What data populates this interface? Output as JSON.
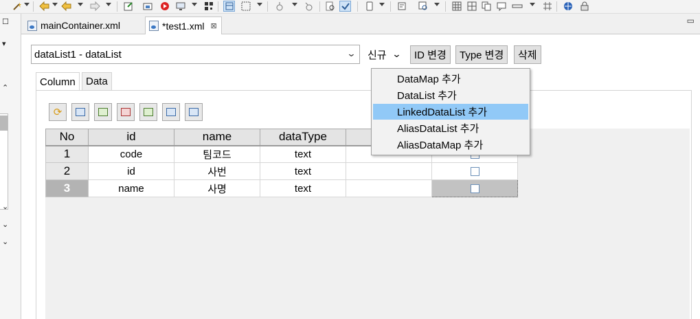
{
  "toolbar": {
    "icons": [
      "wand-icon",
      "back-arrow-icon",
      "forward-arrow-icon",
      "new-file-icon",
      "open-icon",
      "run-icon",
      "monitor-icon",
      "qr-icon",
      "layout-active-icon",
      "grid-select-icon",
      "node-icon",
      "node2-icon",
      "find-icon",
      "spell-check-icon",
      "phone-icon",
      "tag-icon",
      "inspect-icon",
      "table-grid-icon",
      "copy-icon",
      "comment-icon",
      "line-icon",
      "hash-icon",
      "globe-icon",
      "lock-icon"
    ]
  },
  "editor_tabs": [
    {
      "label": "mainContainer.xml",
      "active": false
    },
    {
      "label": "*test1.xml",
      "active": true,
      "close": "⊠"
    }
  ],
  "header": {
    "combo_value": "dataList1 - dataList",
    "new_menu_label": "신규",
    "id_change_label": "ID 변경",
    "type_change_label": "Type 변경",
    "delete_label": "삭제"
  },
  "inner_tabs": [
    {
      "label": "Column",
      "active": true
    },
    {
      "label": "Data",
      "active": false
    }
  ],
  "grid": {
    "columns": [
      "No",
      "id",
      "name",
      "dataType",
      "",
      ""
    ],
    "rows": [
      {
        "no": "1",
        "id": "code",
        "name": "팀코드",
        "dataType": "text",
        "checked": false
      },
      {
        "no": "2",
        "id": "id",
        "name": "사번",
        "dataType": "text",
        "checked": false
      },
      {
        "no": "3",
        "id": "name",
        "name": "사명",
        "dataType": "text",
        "checked": false,
        "selected": true
      }
    ]
  },
  "popup_menu": {
    "items": [
      {
        "label": "DataMap 추가",
        "highlighted": false
      },
      {
        "label": "DataList 추가",
        "highlighted": false
      },
      {
        "label": "LinkedDataList 추가",
        "highlighted": true
      },
      {
        "label": "AliasDataList 추가",
        "highlighted": false
      },
      {
        "label": "AliasDataMap 추가",
        "highlighted": false
      }
    ]
  },
  "colors": {
    "highlight": "#91c9f7",
    "selected_row": "#b3b3b3",
    "button_bg": "#e1e1e1"
  }
}
